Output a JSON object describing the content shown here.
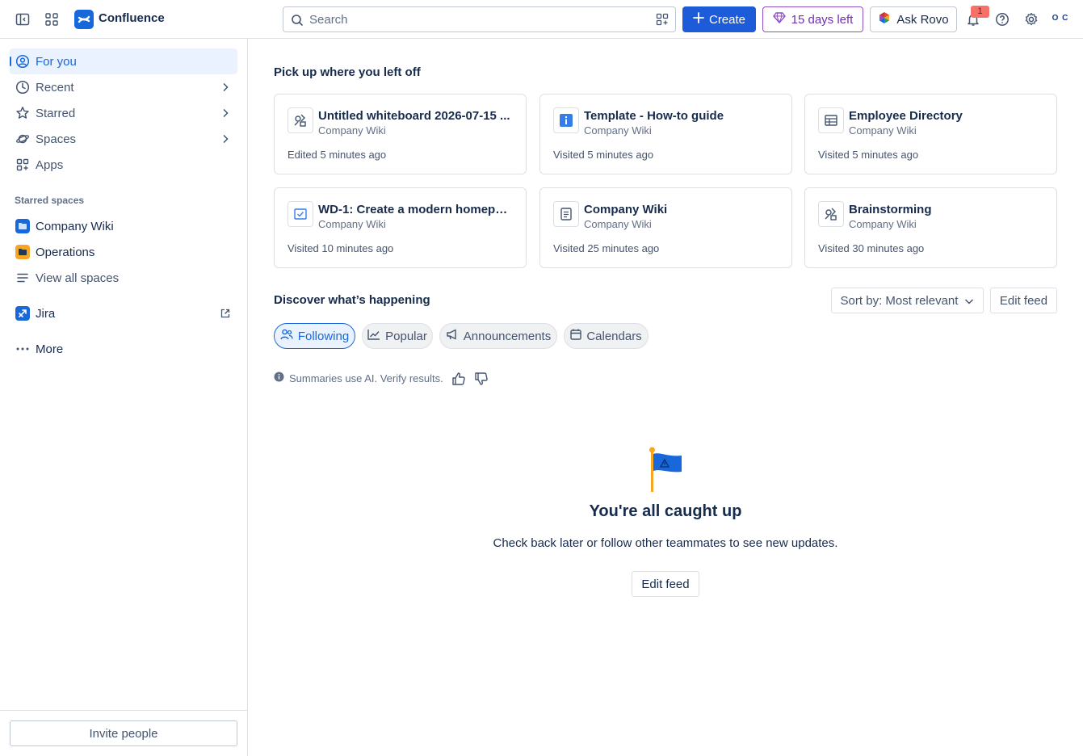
{
  "topbar": {
    "app_name": "Confluence",
    "search_placeholder": "Search",
    "create_label": "Create",
    "trial_label": "15 days left",
    "rovo_label": "Ask Rovo",
    "notification_count": "1",
    "avatar_initials": "O C"
  },
  "sidebar": {
    "items": [
      {
        "label": "For you",
        "icon": "user-circle-icon",
        "active": true
      },
      {
        "label": "Recent",
        "icon": "clock-icon"
      },
      {
        "label": "Starred",
        "icon": "star-icon"
      },
      {
        "label": "Spaces",
        "icon": "planet-icon"
      },
      {
        "label": "Apps",
        "icon": "apps-icon"
      }
    ],
    "starred_heading": "Starred spaces",
    "spaces": [
      {
        "label": "Company Wiki",
        "color": "#1868db"
      },
      {
        "label": "Operations",
        "color": "#f5a623"
      }
    ],
    "view_all": "View all spaces",
    "jira": "Jira",
    "more": "More",
    "invite": "Invite people"
  },
  "main": {
    "recent_heading": "Pick up where you left off",
    "cards": [
      {
        "title": "Untitled whiteboard 2026-07-15 ...",
        "space": "Company Wiki",
        "meta": "Edited 5 minutes ago",
        "icon": "whiteboard-icon"
      },
      {
        "title": "Template - How-to guide",
        "space": "Company Wiki",
        "meta": "Visited 5 minutes ago",
        "icon": "info-icon"
      },
      {
        "title": "Employee Directory",
        "space": "Company Wiki",
        "meta": "Visited 5 minutes ago",
        "icon": "table-icon"
      },
      {
        "title": "WD-1: Create a modern homepa...",
        "space": "Company Wiki",
        "meta": "Visited 10 minutes ago",
        "icon": "checkbox-icon"
      },
      {
        "title": "Company Wiki",
        "space": "Company Wiki",
        "meta": "Visited 25 minutes ago",
        "icon": "page-icon"
      },
      {
        "title": "Brainstorming",
        "space": "Company Wiki",
        "meta": "Visited 30 minutes ago",
        "icon": "whiteboard-icon"
      }
    ],
    "discover_heading": "Discover what’s happening",
    "sort_label": "Sort by: Most relevant",
    "edit_feed": "Edit feed",
    "tabs": [
      {
        "label": "Following",
        "icon": "people-icon",
        "active": true
      },
      {
        "label": "Popular",
        "icon": "trending-icon"
      },
      {
        "label": "Announcements",
        "icon": "megaphone-icon"
      },
      {
        "label": "Calendars",
        "icon": "calendar-icon"
      }
    ],
    "ai_note": "Summaries use AI. Verify results.",
    "empty_title": "You're all caught up",
    "empty_desc": "Check back later or follow other teammates to see new updates.",
    "empty_button": "Edit feed"
  }
}
